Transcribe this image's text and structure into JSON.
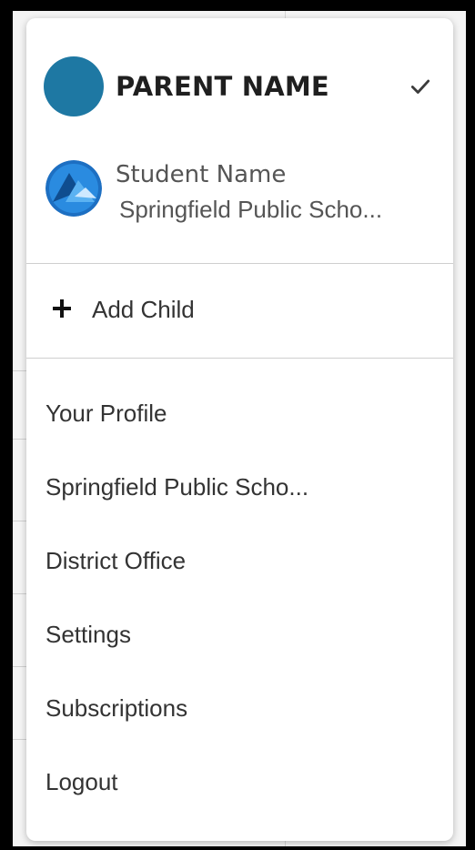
{
  "account_menu": {
    "parent": {
      "name": "PARENT NAME",
      "avatar_color": "#1e78a3",
      "selected_icon": "check-icon"
    },
    "children": [
      {
        "name": "Student Name",
        "school": "Springfield Public Scho...",
        "avatar_color": "#1f7fd0"
      }
    ],
    "add_child_label": "Add Child",
    "add_child_icon": "plus-icon",
    "items": [
      {
        "label": "Your Profile"
      },
      {
        "label": "Springfield Public Scho..."
      },
      {
        "label": "District Office"
      },
      {
        "label": "Settings"
      },
      {
        "label": "Subscriptions"
      },
      {
        "label": "Logout"
      }
    ]
  }
}
